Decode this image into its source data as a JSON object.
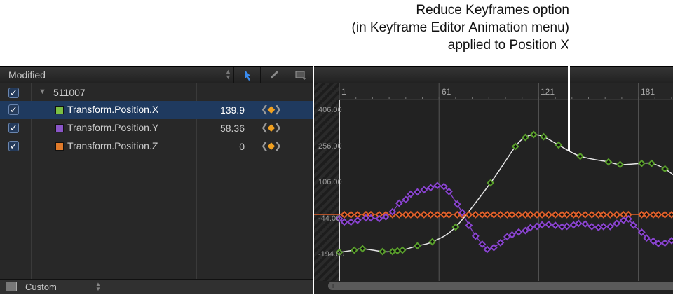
{
  "annotation": {
    "lines": [
      "Reduce Keyframes option",
      "(in Keyframe Editor Animation menu)",
      "applied to Position X"
    ]
  },
  "left_panel": {
    "filter": "Modified",
    "tools": [
      "arrow-select-icon",
      "pencil-icon",
      "box-select-icon"
    ],
    "group": {
      "name": "511007"
    },
    "params": [
      {
        "name": "Transform.Position.X",
        "value": "139.9",
        "color": "#7bc043",
        "selected": true
      },
      {
        "name": "Transform.Position.Y",
        "value": "58.36",
        "color": "#8a55c8",
        "selected": false
      },
      {
        "name": "Transform.Position.Z",
        "value": "0",
        "color": "#e07a2a",
        "selected": false
      }
    ],
    "footer": {
      "preset": "Custom"
    }
  },
  "graph": {
    "ruler_labels": [
      "1",
      "61",
      "121",
      "181"
    ],
    "ruler_frames": [
      1,
      61,
      121,
      181
    ],
    "y_labels": [
      "406.00",
      "256.00",
      "106.00",
      "-44.00",
      "-194.00"
    ],
    "y_values": [
      406,
      256,
      106,
      -44,
      -194
    ],
    "colors": {
      "x": "#5aa02c",
      "y": "#8a44d0",
      "z": "#e0602a",
      "curve": "#e8e8e8"
    },
    "position_x": [
      [
        1,
        -188
      ],
      [
        10,
        -179
      ],
      [
        15,
        -173
      ],
      [
        27,
        -185
      ],
      [
        33,
        -185
      ],
      [
        36,
        -182
      ],
      [
        39,
        -179
      ],
      [
        48,
        -161
      ],
      [
        57,
        -144
      ],
      [
        71,
        -82
      ],
      [
        92,
        103
      ],
      [
        107,
        256
      ],
      [
        113,
        294
      ],
      [
        118,
        306
      ],
      [
        124,
        297
      ],
      [
        133,
        262
      ],
      [
        146,
        215
      ],
      [
        163,
        191
      ],
      [
        170,
        180
      ],
      [
        183,
        185
      ],
      [
        189,
        185
      ],
      [
        197,
        162
      ],
      [
        205,
        120
      ]
    ],
    "position_y": [
      [
        1,
        -47
      ],
      [
        4,
        -61
      ],
      [
        8,
        -61
      ],
      [
        12,
        -54
      ],
      [
        17,
        -44
      ],
      [
        20,
        -44
      ],
      [
        25,
        -47
      ],
      [
        29,
        -39
      ],
      [
        33,
        -18
      ],
      [
        37,
        18
      ],
      [
        41,
        33
      ],
      [
        44,
        56
      ],
      [
        48,
        65
      ],
      [
        52,
        74
      ],
      [
        56,
        83
      ],
      [
        60,
        92
      ],
      [
        64,
        88
      ],
      [
        67,
        67
      ],
      [
        72,
        14
      ],
      [
        75,
        -21
      ],
      [
        79,
        -75
      ],
      [
        83,
        -120
      ],
      [
        87,
        -154
      ],
      [
        90,
        -176
      ],
      [
        94,
        -168
      ],
      [
        98,
        -148
      ],
      [
        102,
        -123
      ],
      [
        105,
        -115
      ],
      [
        109,
        -103
      ],
      [
        113,
        -97
      ],
      [
        116,
        -85
      ],
      [
        120,
        -79
      ],
      [
        123,
        -73
      ],
      [
        127,
        -71
      ],
      [
        131,
        -75
      ],
      [
        135,
        -81
      ],
      [
        138,
        -79
      ],
      [
        142,
        -73
      ],
      [
        145,
        -67
      ],
      [
        149,
        -69
      ],
      [
        153,
        -80
      ],
      [
        157,
        -84
      ],
      [
        160,
        -80
      ],
      [
        164,
        -80
      ],
      [
        168,
        -67
      ],
      [
        172,
        -54
      ],
      [
        175,
        -48
      ],
      [
        178,
        -74
      ],
      [
        183,
        -104
      ],
      [
        186,
        -128
      ],
      [
        190,
        -141
      ],
      [
        193,
        -151
      ],
      [
        197,
        -149
      ],
      [
        201,
        -139
      ]
    ],
    "position_z_value": -30,
    "position_z_frames": [
      4,
      8,
      12,
      17,
      20,
      25,
      29,
      33,
      37,
      41,
      44,
      48,
      52,
      56,
      60,
      64,
      67,
      72,
      75,
      79,
      83,
      87,
      90,
      94,
      98,
      102,
      105,
      109,
      113,
      116,
      120,
      123,
      127,
      131,
      135,
      138,
      142,
      145,
      149,
      153,
      157,
      160,
      164,
      168,
      172,
      175,
      183,
      186,
      190,
      193,
      197,
      201
    ]
  }
}
